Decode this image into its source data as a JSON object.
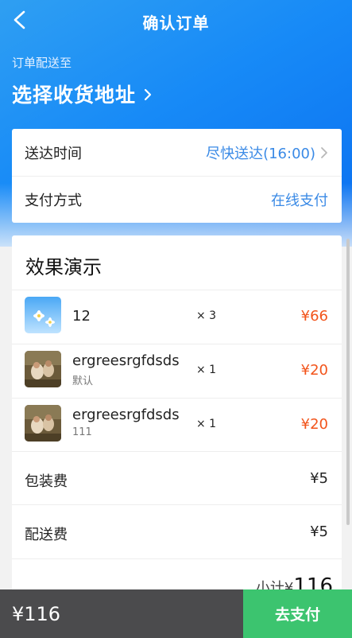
{
  "header": {
    "title": "确认订单",
    "back_icon": "chevron-left-icon"
  },
  "address": {
    "label": "订单配送至",
    "select_text": "选择收货地址"
  },
  "info": {
    "delivery_time_label": "送达时间",
    "delivery_time_value": "尽快送达(16:00)",
    "payment_label": "支付方式",
    "payment_value": "在线支付"
  },
  "order": {
    "shop_name": "效果演示",
    "items": [
      {
        "name": "12",
        "spec": "",
        "qty": "× 3",
        "price": "¥66",
        "thumb": "blue-flower-image"
      },
      {
        "name": "ergreesrgfdsds",
        "spec": "默认",
        "qty": "× 1",
        "price": "¥20",
        "thumb": "painting-image"
      },
      {
        "name": "ergreesrgfdsds",
        "spec": "111",
        "qty": "× 1",
        "price": "¥20",
        "thumb": "painting-image"
      }
    ],
    "packing_fee_label": "包装费",
    "packing_fee_value": "¥5",
    "delivery_fee_label": "配送费",
    "delivery_fee_value": "¥5",
    "subtotal_label": "小计¥",
    "subtotal_value": "116"
  },
  "footer": {
    "total": "¥116",
    "pay_label": "去支付"
  },
  "colors": {
    "accent_blue": "#178af7",
    "price_red": "#f2541b",
    "pay_green": "#3cc46f",
    "footer_dark": "#4b4b4d",
    "link_blue": "#3a8ae6"
  }
}
